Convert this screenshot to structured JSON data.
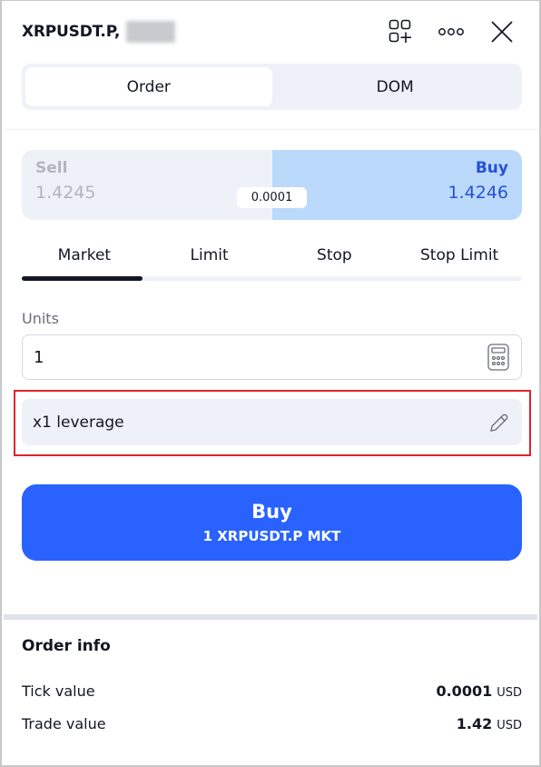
{
  "header": {
    "symbol": "XRPUSDT.P,",
    "redacted_label": "redacted account",
    "icons": [
      "add-widget-icon",
      "more-icon",
      "close-icon"
    ]
  },
  "mode_tabs": [
    {
      "label": "Order",
      "active": true
    },
    {
      "label": "DOM",
      "active": false
    }
  ],
  "quote": {
    "sell_label": "Sell",
    "sell_price": "1.4245",
    "buy_label": "Buy",
    "buy_price": "1.4246",
    "spread": "0.0001",
    "selected_side": "Buy"
  },
  "order_types": [
    {
      "label": "Market",
      "active": true
    },
    {
      "label": "Limit",
      "active": false
    },
    {
      "label": "Stop",
      "active": false
    },
    {
      "label": "Stop Limit",
      "active": false
    }
  ],
  "units": {
    "label": "Units",
    "value": "1",
    "calculator_icon": "calculator-icon"
  },
  "leverage": {
    "label": "x1 leverage",
    "edit_icon": "pencil-icon"
  },
  "submit": {
    "title": "Buy",
    "subtitle": "1 XRPUSDT.P MKT"
  },
  "order_info": {
    "title": "Order info",
    "rows": [
      {
        "label": "Tick value",
        "value": "0.0001",
        "currency": "USD"
      },
      {
        "label": "Trade value",
        "value": "1.42",
        "currency": "USD"
      }
    ]
  },
  "colors": {
    "accent": "#2962ff",
    "buy_bg": "#bbd9fb",
    "buy_text": "#2751d6",
    "sell_bg": "#eef1f8",
    "highlight_border": "#e0222d"
  }
}
